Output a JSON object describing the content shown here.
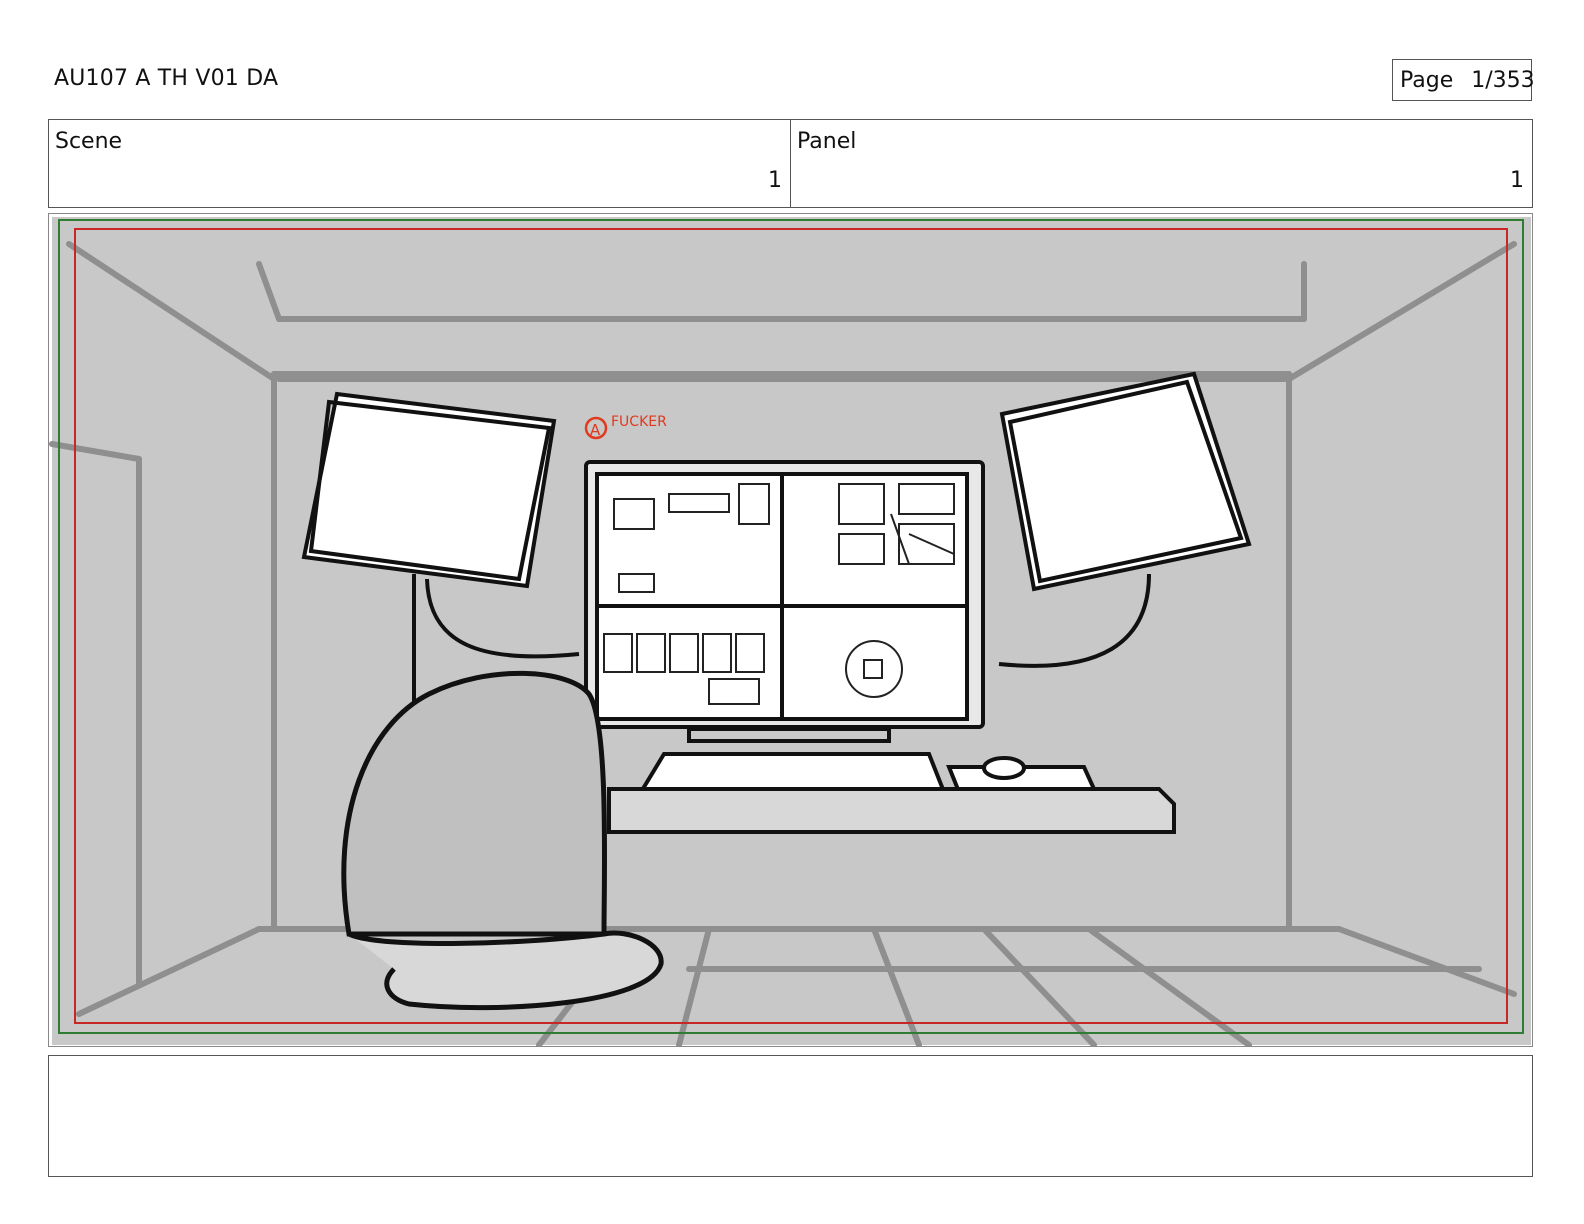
{
  "document": {
    "title": "AU107 A TH V01 DA",
    "page": {
      "label": "Page",
      "value": "1/353"
    }
  },
  "header": {
    "scene": {
      "label": "Scene",
      "value": "1"
    },
    "panel": {
      "label": "Panel",
      "value": "1"
    }
  },
  "sketch": {
    "annotation_circle": "A",
    "annotation_text": "FUCKER",
    "colors": {
      "background": "#c8c8c8",
      "line": "#111111",
      "annotation": "#e03a1e",
      "safe_outer": "#2e7d32",
      "safe_inner": "#c62828"
    }
  },
  "notes": {
    "text": ""
  }
}
